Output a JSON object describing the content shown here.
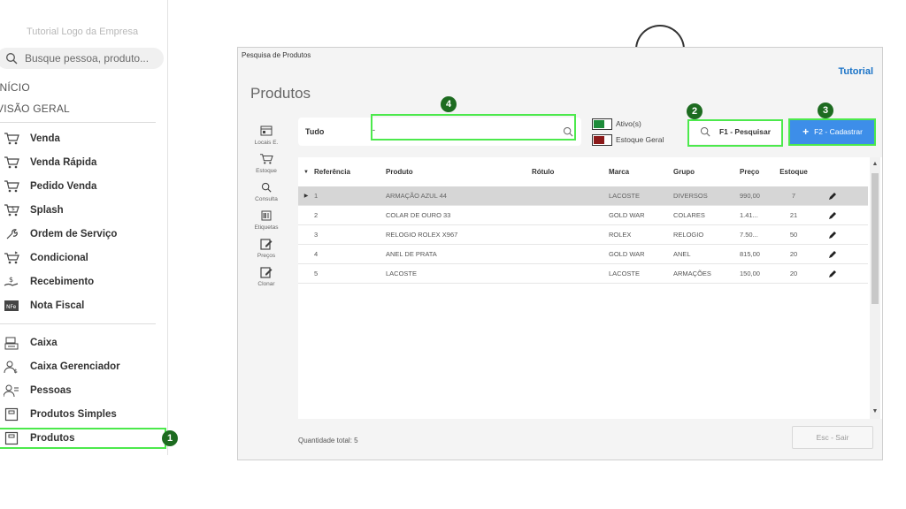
{
  "sidebar": {
    "top_cut_text": "Tutorial Logo da Empresa",
    "search_placeholder": "Busque pessoa, produto...",
    "sections": {
      "inicio": "INÍCIO",
      "visao_geral": "VISÃO GERAL"
    },
    "items": [
      {
        "label": "Venda",
        "icon": "cart-icon"
      },
      {
        "label": "Venda Rápida",
        "icon": "cart-icon"
      },
      {
        "label": "Pedido Venda",
        "icon": "cart-icon"
      },
      {
        "label": "Splash",
        "icon": "cart-dollar-icon"
      },
      {
        "label": "Ordem de Serviço",
        "icon": "wrench-icon"
      },
      {
        "label": "Condicional",
        "icon": "cart-arrow-icon"
      },
      {
        "label": "Recebimento",
        "icon": "hand-money-icon"
      },
      {
        "label": "Nota Fiscal",
        "icon": "nfe-icon"
      },
      {
        "label": "Caixa",
        "icon": "register-icon"
      },
      {
        "label": "Caixa Gerenciador",
        "icon": "user-money-icon"
      },
      {
        "label": "Pessoas",
        "icon": "users-icon"
      },
      {
        "label": "Produtos Simples",
        "icon": "box-icon"
      },
      {
        "label": "Produtos",
        "icon": "box-icon"
      }
    ],
    "active_item": "Produtos"
  },
  "badges": [
    "1",
    "2",
    "3",
    "4"
  ],
  "window": {
    "title": "Pesquisa de Produtos",
    "tutorial": "Tutorial",
    "heading": "Produtos",
    "tools": [
      {
        "label": "Locais E.",
        "icon": "locais-icon"
      },
      {
        "label": "Estoque",
        "icon": "cart-icon"
      },
      {
        "label": "Consulta",
        "icon": "search-icon"
      },
      {
        "label": "Etiquetas",
        "icon": "barcode-icon"
      },
      {
        "label": "Preços",
        "icon": "edit-price-icon"
      },
      {
        "label": "Clonar",
        "icon": "clone-icon"
      }
    ],
    "filter": {
      "label": "Tudo",
      "dash": "-",
      "value": ""
    },
    "legend": [
      {
        "label": "Ativo(s)",
        "color": "#1e8c3a"
      },
      {
        "label": "Estoque Geral",
        "color": "#8b1a1a"
      }
    ],
    "search_button": "F1 - Pesquisar",
    "add_button": "F2 - Cadastrar",
    "columns": {
      "referencia": "Referência",
      "produto": "Produto",
      "rotulo": "Rótulo",
      "marca": "Marca",
      "grupo": "Grupo",
      "preco": "Preço",
      "estoque": "Estoque"
    },
    "rows": [
      {
        "ref": "1",
        "produto": "ARMAÇÃO AZUL 44",
        "rotulo": "",
        "marca": "LACOSTE",
        "grupo": "DIVERSOS",
        "preco": "990,00",
        "estoque": "7"
      },
      {
        "ref": "2",
        "produto": "COLAR DE OURO 33",
        "rotulo": "",
        "marca": "GOLD WAR",
        "grupo": "COLARES",
        "preco": "1.41...",
        "estoque": "21"
      },
      {
        "ref": "3",
        "produto": "RELOGIO ROLEX X967",
        "rotulo": "",
        "marca": "ROLEX",
        "grupo": "RELOGIO",
        "preco": "7.50...",
        "estoque": "50"
      },
      {
        "ref": "4",
        "produto": "ANEL DE PRATA",
        "rotulo": "",
        "marca": "GOLD WAR",
        "grupo": "ANEL",
        "preco": "815,00",
        "estoque": "20"
      },
      {
        "ref": "5",
        "produto": "LACOSTE",
        "rotulo": "",
        "marca": "LACOSTE",
        "grupo": "ARMAÇÕES",
        "preco": "150,00",
        "estoque": "20"
      }
    ],
    "footer_count": "Quantidade total: 5",
    "exit_button": "Esc - Sair"
  },
  "colors": {
    "highlight": "#4ce94c",
    "badge": "#1d6b20",
    "accent": "#3d8ee9",
    "tutorial": "#1a73c7"
  }
}
